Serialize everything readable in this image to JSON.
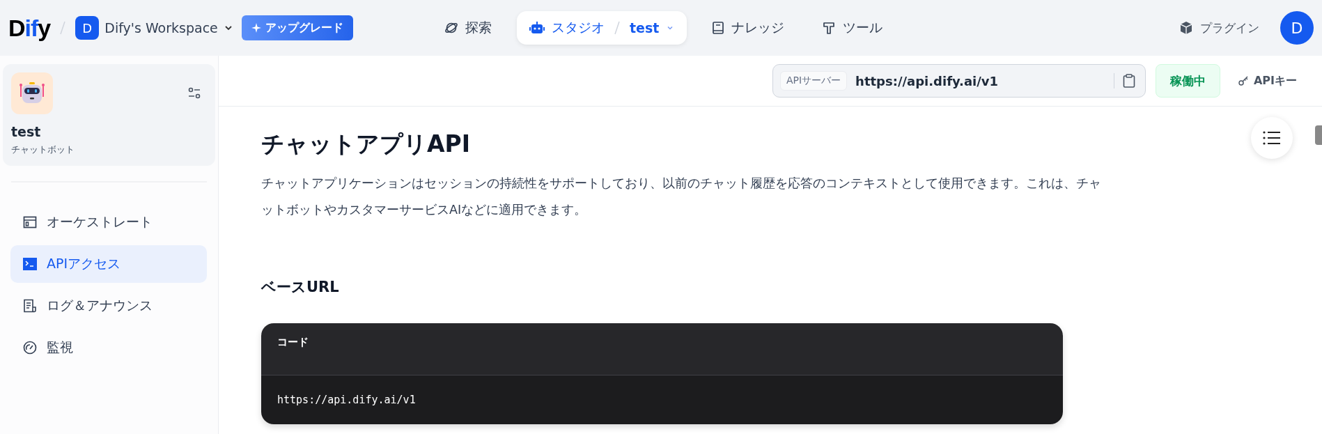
{
  "header": {
    "logo": "Dify",
    "workspace": {
      "initial": "D",
      "name": "Dify's Workspace"
    },
    "upgrade": "アップグレード",
    "nav": [
      {
        "kind": "explore",
        "label": "探索",
        "selected": false
      },
      {
        "kind": "studio",
        "label": "スタジオ",
        "selected": true,
        "app": "test"
      },
      {
        "kind": "knowledge",
        "label": "ナレッジ",
        "selected": false
      },
      {
        "kind": "tools",
        "label": "ツール",
        "selected": false
      }
    ],
    "plugins": "プラグイン",
    "avatar": "D"
  },
  "sidebar": {
    "app": {
      "name": "test",
      "type": "チャットボット"
    },
    "items": [
      {
        "kind": "orchestrate",
        "label": "オーケストレート",
        "selected": false
      },
      {
        "kind": "api",
        "label": "APIアクセス",
        "selected": true
      },
      {
        "kind": "logs",
        "label": "ログ＆アナウンス",
        "selected": false
      },
      {
        "kind": "monitor",
        "label": "監視",
        "selected": false
      }
    ]
  },
  "api_bar": {
    "label": "APIサーバー",
    "url": "https://api.dify.ai/v1",
    "status": "稼働中",
    "running": true,
    "api_key": "APIキー"
  },
  "content": {
    "title": "チャットアプリAPI",
    "description": "チャットアプリケーションはセッションの持続性をサポートしており、以前のチャット履歴を応答のコンテキストとして使用できます。これは、チャットボットやカスタマーサービスAIなどに適用できます。",
    "section": "ベースURL",
    "code": {
      "label": "コード",
      "text": "https://api.dify.ai/v1"
    }
  }
}
